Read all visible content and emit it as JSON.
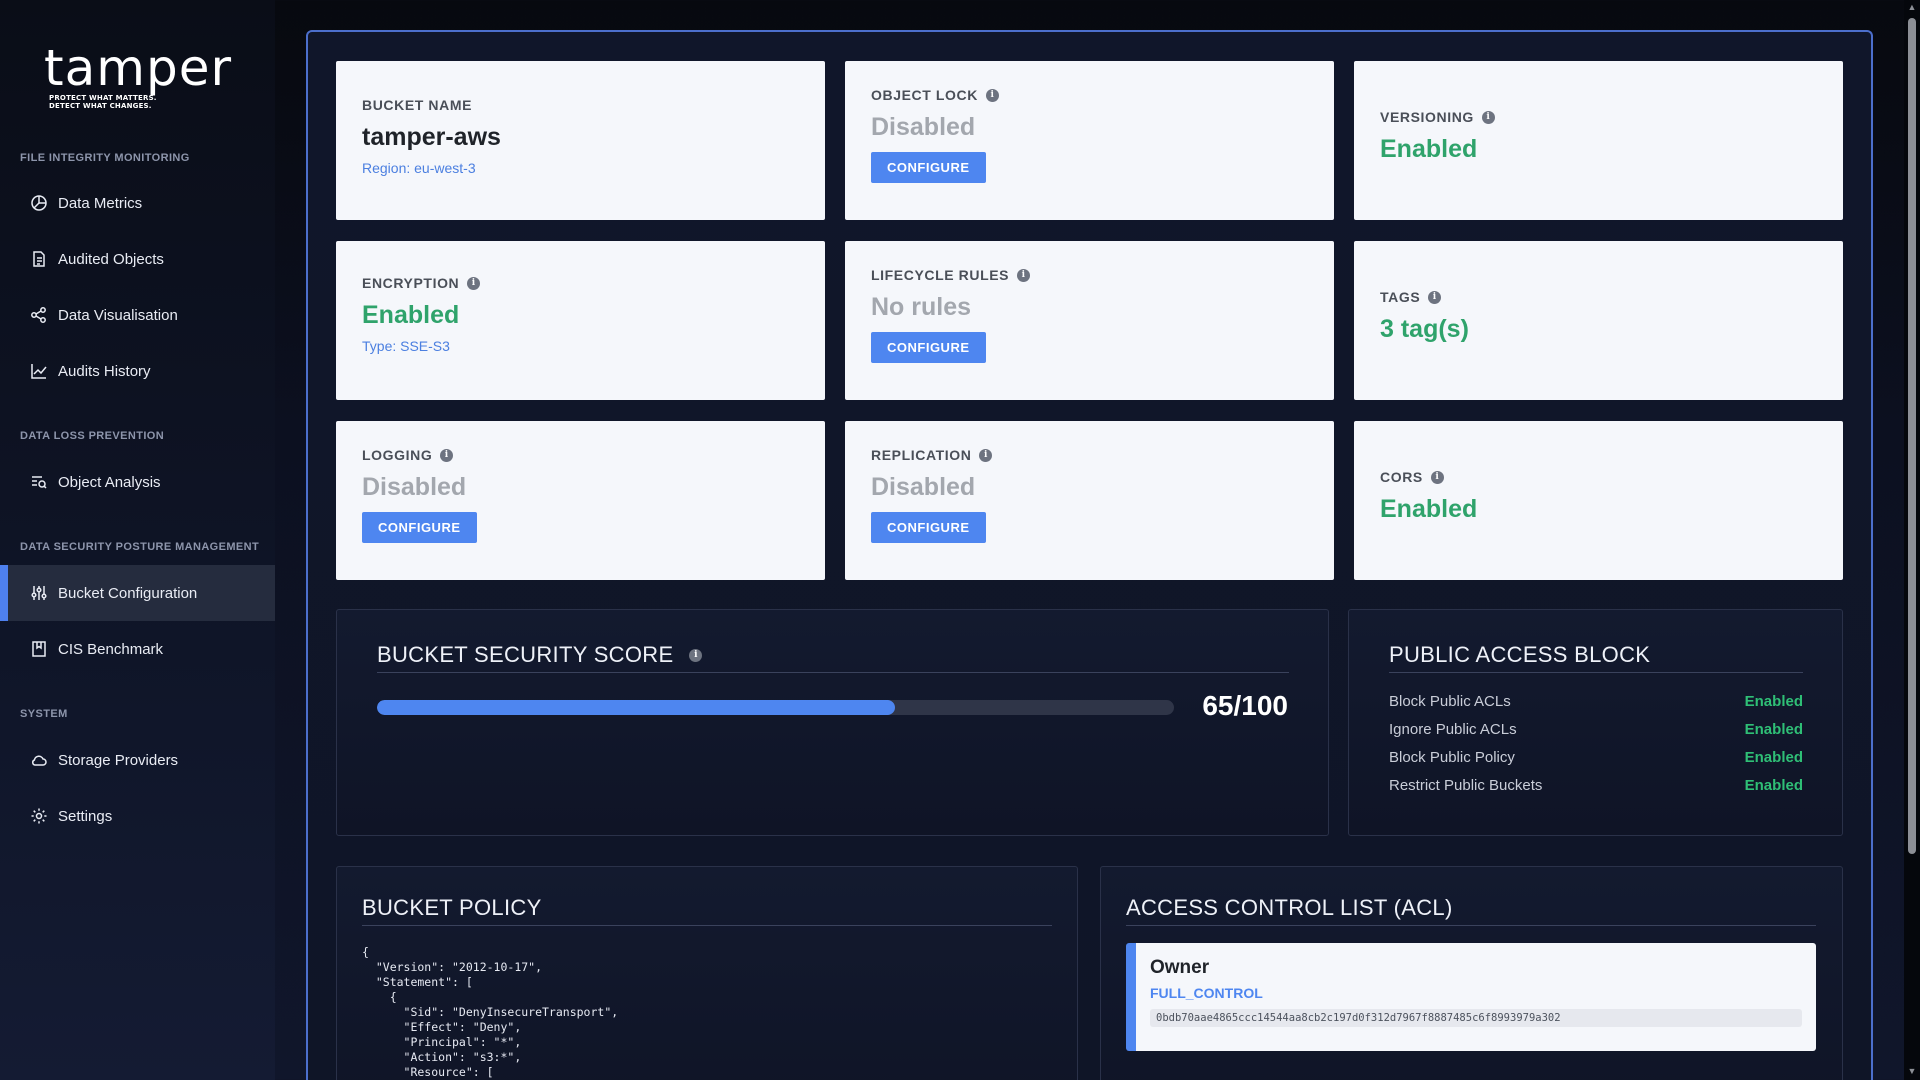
{
  "brand": {
    "name": "tamper",
    "tagline_1": "PROTECT WHAT MATTERS.",
    "tagline_2": "DETECT WHAT CHANGES."
  },
  "sidebar": {
    "sections": [
      {
        "label": "FILE INTEGRITY MONITORING"
      },
      {
        "label": "DATA LOSS PREVENTION"
      },
      {
        "label": "DATA SECURITY POSTURE MANAGEMENT"
      },
      {
        "label": "SYSTEM"
      }
    ],
    "items": [
      {
        "label": "Data Metrics",
        "icon": "pie-chart-icon"
      },
      {
        "label": "Audited Objects",
        "icon": "document-icon"
      },
      {
        "label": "Data Visualisation",
        "icon": "graph-nodes-icon"
      },
      {
        "label": "Audits History",
        "icon": "line-chart-icon"
      },
      {
        "label": "Object Analysis",
        "icon": "list-search-icon"
      },
      {
        "label": "Bucket Configuration",
        "icon": "sliders-icon",
        "active": true
      },
      {
        "label": "CIS Benchmark",
        "icon": "bookmark-book-icon"
      },
      {
        "label": "Storage Providers",
        "icon": "cloud-icon"
      },
      {
        "label": "Settings",
        "icon": "gear-icon"
      }
    ]
  },
  "cards": {
    "bucket": {
      "label": "BUCKET NAME",
      "value": "tamper-aws",
      "sub": "Region: eu-west-3"
    },
    "object_lock": {
      "label": "OBJECT LOCK",
      "value": "Disabled",
      "button": "CONFIGURE"
    },
    "versioning": {
      "label": "VERSIONING",
      "value": "Enabled"
    },
    "encryption": {
      "label": "ENCRYPTION",
      "value": "Enabled",
      "sub": "Type: SSE-S3"
    },
    "lifecycle": {
      "label": "LIFECYCLE RULES",
      "value": "No rules",
      "button": "CONFIGURE"
    },
    "tags": {
      "label": "TAGS",
      "value": "3 tag(s)"
    },
    "logging": {
      "label": "LOGGING",
      "value": "Disabled",
      "button": "CONFIGURE"
    },
    "replication": {
      "label": "REPLICATION",
      "value": "Disabled",
      "button": "CONFIGURE"
    },
    "cors": {
      "label": "CORS",
      "value": "Enabled"
    }
  },
  "security_score": {
    "title": "BUCKET SECURITY SCORE",
    "score": 65,
    "max": 100,
    "display": "65/100"
  },
  "public_access_block": {
    "title": "PUBLIC ACCESS BLOCK",
    "rows": [
      {
        "key": "Block Public ACLs",
        "value": "Enabled"
      },
      {
        "key": "Ignore Public ACLs",
        "value": "Enabled"
      },
      {
        "key": "Block Public Policy",
        "value": "Enabled"
      },
      {
        "key": "Restrict Public Buckets",
        "value": "Enabled"
      }
    ]
  },
  "bucket_policy": {
    "title": "BUCKET POLICY",
    "code": "{\n  \"Version\": \"2012-10-17\",\n  \"Statement\": [\n    {\n      \"Sid\": \"DenyInsecureTransport\",\n      \"Effect\": \"Deny\",\n      \"Principal\": \"*\",\n      \"Action\": \"s3:*\",\n      \"Resource\": ["
  },
  "acl": {
    "title": "ACCESS CONTROL LIST (ACL)",
    "entries": [
      {
        "name": "Owner",
        "permission": "FULL_CONTROL",
        "id": "0bdb70aae4865ccc14544aa8cb2c197d0f312d7967f8887485c6f8993979a302"
      }
    ]
  },
  "colors": {
    "accent": "#4e86f0",
    "enabled": "#2fa36b",
    "disabled": "#a3a7ae",
    "sidebar_active": "#252c3e"
  }
}
